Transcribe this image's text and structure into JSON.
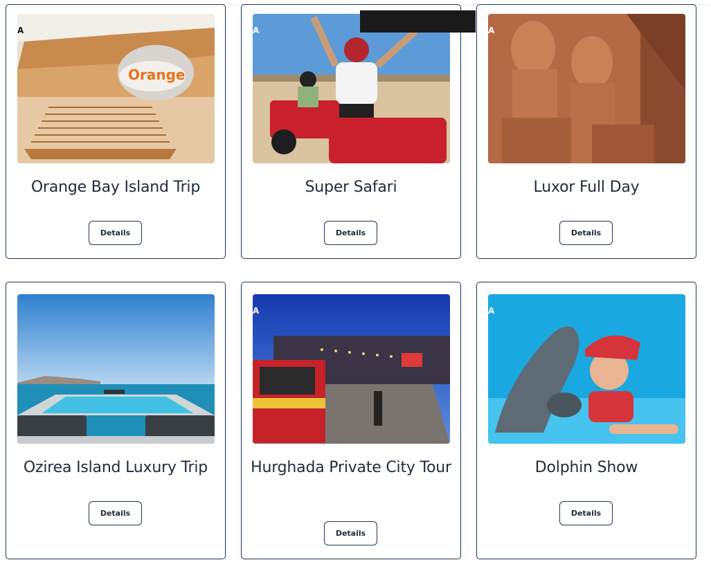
{
  "cards": [
    {
      "title": "Orange Bay Island Trip",
      "image_alt": "Orange Bay staircase",
      "button_label": "Details"
    },
    {
      "title": "Super Safari",
      "image_alt": "Quad bike riders in desert",
      "button_label": "Details"
    },
    {
      "title": "Luxor Full Day",
      "image_alt": "Abu Simbel statues",
      "button_label": "Details"
    },
    {
      "title": "Ozirea Island Luxury Trip",
      "image_alt": "Infinity pool by the sea",
      "button_label": "Details"
    },
    {
      "title": "Hurghada Private City Tour",
      "image_alt": "City street at night",
      "button_label": "Details"
    },
    {
      "title": "Dolphin Show",
      "image_alt": "Boy kissing a dolphin",
      "button_label": "Details"
    }
  ],
  "image_logo_text": "A",
  "image_sign_text": "Orange"
}
